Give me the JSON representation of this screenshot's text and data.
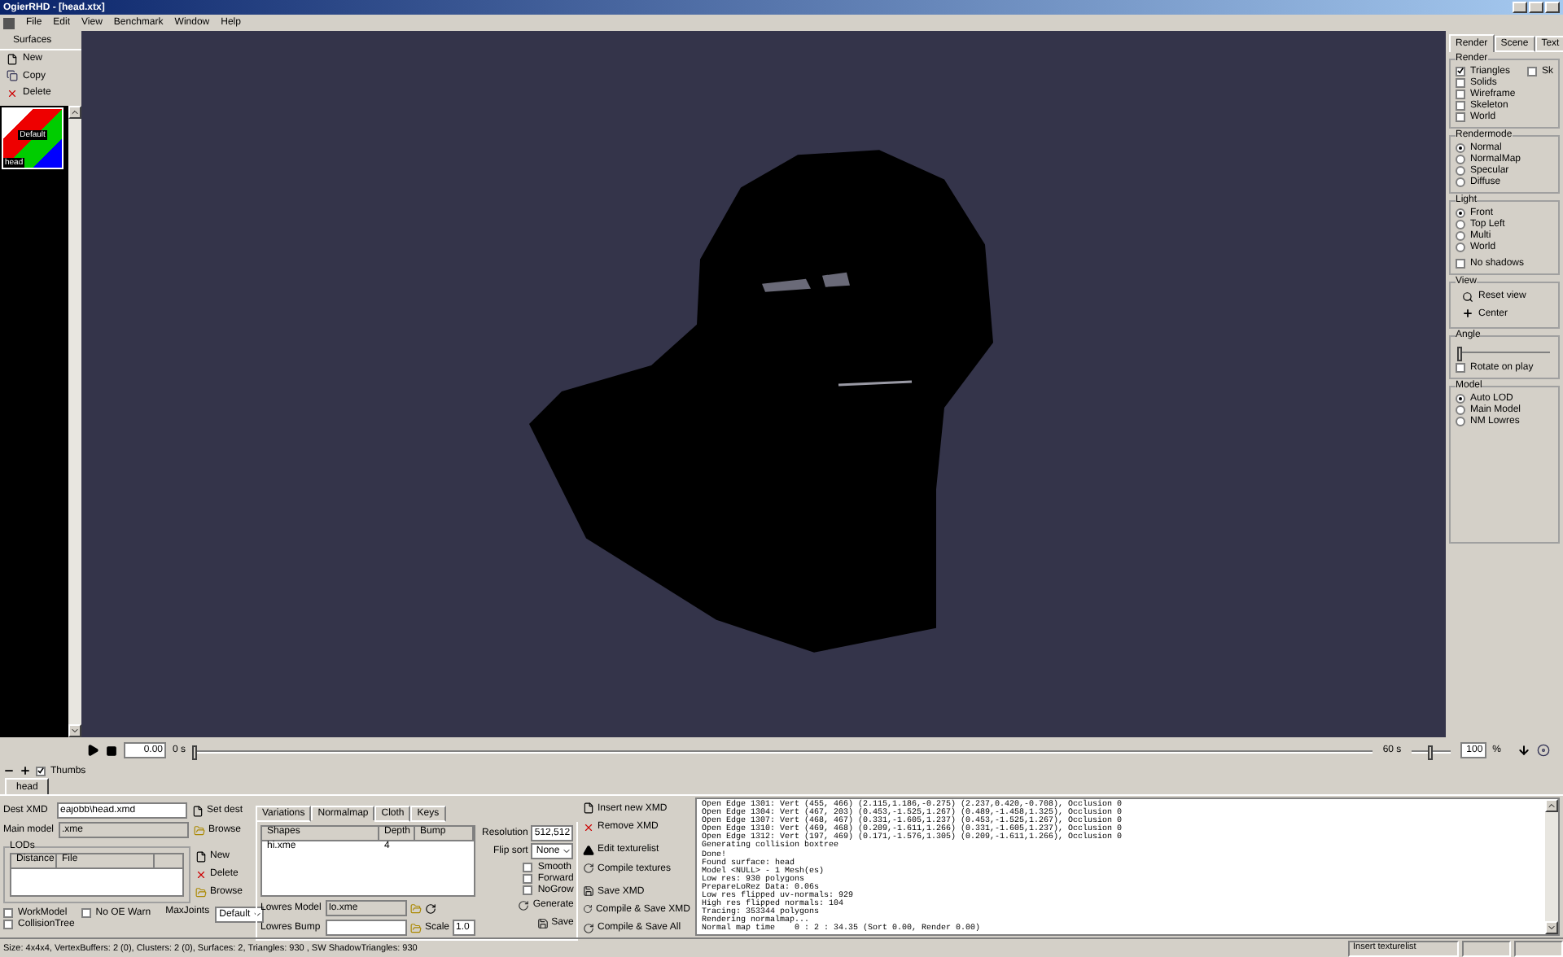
{
  "window": {
    "title": "OgierRHD - [head.xtx]"
  },
  "menu": [
    "File",
    "Edit",
    "View",
    "Benchmark",
    "Window",
    "Help"
  ],
  "surfaces": {
    "title": "Surfaces",
    "actions": [
      {
        "kind": "new",
        "label": "New"
      },
      {
        "kind": "copy",
        "label": "Copy"
      },
      {
        "kind": "delete",
        "label": "Delete"
      }
    ],
    "thumbnails": [
      {
        "caption": "Default",
        "name": "head",
        "selected": true
      }
    ]
  },
  "right_panel": {
    "tabs": [
      {
        "label": "Render",
        "selected": true
      },
      {
        "label": "Scene",
        "selected": false
      },
      {
        "label": "Text",
        "selected": false
      }
    ],
    "render": {
      "title": "Render",
      "options": [
        {
          "label": "Triangles",
          "checked": true
        },
        {
          "label": "Sk",
          "checked": false
        },
        {
          "label": "Solids",
          "checked": false
        },
        {
          "label": "Wireframe",
          "checked": false
        },
        {
          "label": "Skeleton",
          "checked": false
        },
        {
          "label": "World",
          "checked": false
        }
      ]
    },
    "rendermode": {
      "title": "Rendermode",
      "options": [
        {
          "label": "Normal",
          "selected": true
        },
        {
          "label": "NormalMap",
          "selected": false
        },
        {
          "label": "Specular",
          "selected": false
        },
        {
          "label": "Diffuse",
          "selected": false
        }
      ]
    },
    "light": {
      "title": "Light",
      "options": [
        {
          "label": "Front",
          "selected": true
        },
        {
          "label": "Top Left",
          "selected": false
        },
        {
          "label": "Multi",
          "selected": false
        },
        {
          "label": "World",
          "selected": false
        }
      ],
      "no_shadows": {
        "label": "No shadows",
        "checked": false
      }
    },
    "view": {
      "title": "View",
      "actions": [
        {
          "kind": "reset",
          "label": "Reset view"
        },
        {
          "kind": "center",
          "label": "Center"
        }
      ]
    },
    "angle": {
      "title": "Angle",
      "level": 0.02,
      "rotate_on_play": {
        "label": "Rotate on play",
        "checked": false
      }
    },
    "model": {
      "title": "Model",
      "options": [
        {
          "label": "Auto LOD",
          "selected": true
        },
        {
          "label": "Main Model",
          "selected": false
        },
        {
          "label": "NM Lowres",
          "selected": false
        }
      ]
    }
  },
  "timeline": {
    "time": "0.00",
    "start": "0 s",
    "end": "60 s",
    "level": 0,
    "zoom_slider": {
      "level": 0.5
    },
    "zoom": "100",
    "unit": "%"
  },
  "thumbs": {
    "label": "Thumbs",
    "checked": true
  },
  "doc_tabs": [
    {
      "label": "head",
      "selected": true
    }
  ],
  "xmd": {
    "dest_label": "Dest XMD",
    "dest_value": "eajobb\\head.xmd",
    "main_label": "Main model",
    "main_value": ".xme",
    "buttons": [
      {
        "kind": "new",
        "label": "Set dest"
      },
      {
        "kind": "browse",
        "label": "Browse"
      }
    ],
    "lods": {
      "title": "LODs",
      "columns": [
        "Distance",
        "File"
      ],
      "buttons": [
        {
          "kind": "new",
          "label": "New"
        },
        {
          "kind": "delete",
          "label": "Delete"
        },
        {
          "kind": "browse",
          "label": "Browse"
        }
      ]
    },
    "checks": [
      {
        "label": "WorkModel",
        "checked": false
      },
      {
        "label": "No OE Warn",
        "checked": false
      },
      {
        "label": "CollisionTree",
        "checked": false
      }
    ],
    "max_joints_label": "MaxJoints",
    "max_joints": "Default"
  },
  "normalmap": {
    "tabs": [
      {
        "label": "Variations",
        "selected": false
      },
      {
        "label": "Normalmap",
        "selected": true
      },
      {
        "label": "Cloth",
        "selected": false
      },
      {
        "label": "Keys",
        "selected": false
      }
    ],
    "columns": [
      "Shapes",
      "Depth",
      "Bump"
    ],
    "rows": [
      [
        "hi.xme",
        "4",
        ""
      ]
    ],
    "resolution_label": "Resolution",
    "resolution": "512,512",
    "flip_label": "Flip sort",
    "flip": "None",
    "checks": [
      {
        "label": "Smooth",
        "checked": false
      },
      {
        "label": "Forward",
        "checked": false
      },
      {
        "label": "NoGrow",
        "checked": false
      }
    ],
    "lowres_model_label": "Lowres Model",
    "lowres_model": "lo.xme",
    "lowres_bump_label": "Lowres Bump",
    "scale_label": "Scale",
    "scale": "1.0",
    "generate": "Generate",
    "save": "Save"
  },
  "actions": [
    {
      "kind": "new",
      "label": "Insert new XMD"
    },
    {
      "kind": "delete",
      "label": "Remove XMD"
    },
    {
      "kind": "edit",
      "label": "Edit texturelist"
    },
    {
      "kind": "compile",
      "label": "Compile textures"
    },
    {
      "kind": "save",
      "label": "Save XMD"
    },
    {
      "kind": "compile",
      "label": "Compile & Save XMD"
    },
    {
      "kind": "compile",
      "label": "Compile & Save All"
    }
  ],
  "log": [
    "Open Edge 1301: Vert (455, 466) (2.115,1.186,-0.275) (2.237,0.420,-0.708), Occlusion 0",
    "Open Edge 1304: Vert (467, 203) (0.453,-1.525,1.267) (0.489,-1.458,1.325), Occlusion 0",
    "Open Edge 1307: Vert (468, 467) (0.331,-1.605,1.237) (0.453,-1.525,1.267), Occlusion 0",
    "Open Edge 1310: Vert (469, 468) (0.209,-1.611,1.266) (0.331,-1.605,1.237), Occlusion 0",
    "Open Edge 1312: Vert (197, 469) (0.171,-1.576,1.305) (0.209,-1.611,1.266), Occlusion 0",
    "Generating collision boxtree",
    "Done!",
    "Found surface: head",
    "Model <NULL> - 1 Mesh(es)",
    "Low res: 930 polygons",
    "PrepareLoRez Data: 0.06s",
    "Low res flipped uv-normals: 929",
    "High res flipped normals: 104",
    "Tracing: 353344 polygons",
    "Rendering normalmap...",
    "Normal map time    0 : 2 : 34.35 (Sort 0.00, Render 0.00)"
  ],
  "status_bar": {
    "info": "Size: 4x4x4, VertexBuffers: 2 (0), Clusters: 2 (0), Surfaces: 2, Triangles: 930 , SW ShadowTriangles: 930",
    "hint": "Insert texturelist"
  }
}
